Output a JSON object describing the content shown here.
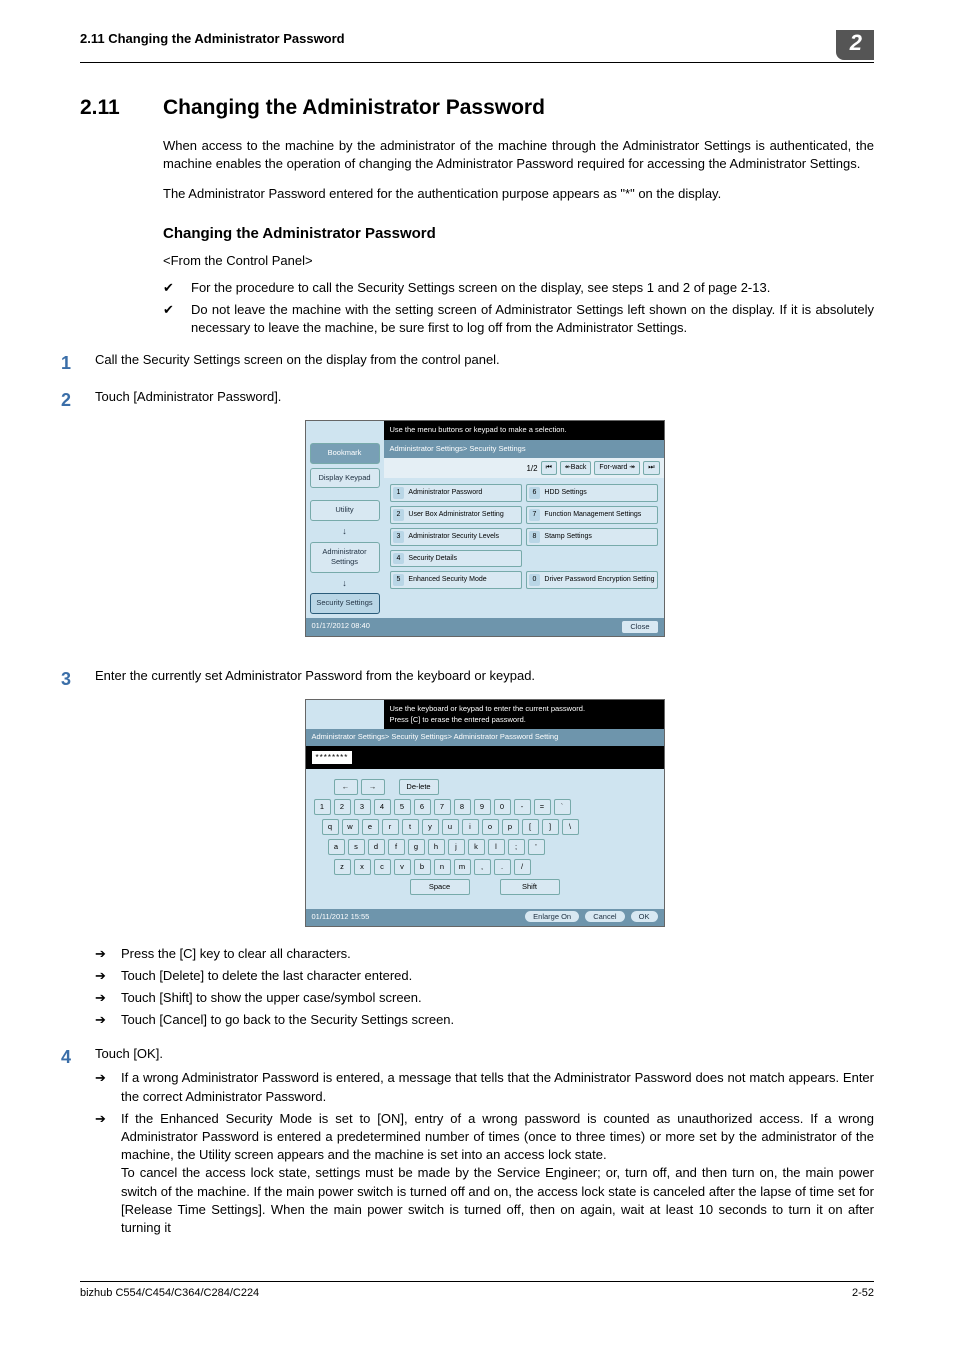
{
  "header": {
    "left": "2.11    Changing the Administrator Password",
    "chapter": "2"
  },
  "section": {
    "num": "2.11",
    "title": "Changing the Administrator Password"
  },
  "para1": "When access to the machine by the administrator of the machine through the Administrator Settings is authenticated, the machine enables the operation of changing the Administrator Password required for accessing the Administrator Settings.",
  "para2": "The Administrator Password entered for the authentication purpose appears as \"*\" on the display.",
  "subhead": "Changing the Administrator Password",
  "angle": "<From the Control Panel>",
  "tick1": "For the procedure to call the Security Settings screen on the display, see steps 1 and 2 of page 2-13.",
  "tick2": "Do not leave the machine with the setting screen of Administrator Settings left shown on the display. If it is absolutely necessary to leave the machine, be sure first to log off from the Administrator Settings.",
  "steps": {
    "s1": {
      "n": "1",
      "t": "Call the Security Settings screen on the display from the control panel."
    },
    "s2": {
      "n": "2",
      "t": "Touch [Administrator Password]."
    },
    "s3": {
      "n": "3",
      "t": "Enter the currently set Administrator Password from the keyboard or keypad."
    },
    "s4": {
      "n": "4",
      "t": "Touch [OK]."
    }
  },
  "sublist3": {
    "a": "Press the [C] key to clear all characters.",
    "b": "Touch [Delete] to delete the last character entered.",
    "c": "Touch [Shift] to show the upper case/symbol screen.",
    "d": "Touch [Cancel] to go back to the Security Settings screen."
  },
  "sublist4": {
    "a": "If a wrong Administrator Password is entered, a message that tells that the Administrator Password does not match appears. Enter the correct Administrator Password.",
    "b": "If the Enhanced Security Mode is set to [ON], entry of a wrong password is counted as unauthorized access. If a wrong Administrator Password is entered a predetermined number of times (once to three times) or more set by the administrator of the machine, the Utility screen appears and the machine is set into an access lock state.",
    "b2": "To cancel the access lock state, settings must be made by the Service Engineer; or, turn off, and then turn on, the main power switch of the machine. If the main power switch is turned off and on, the access lock state is canceled after the lapse of time set for [Release Time Settings]. When the main power switch is turned off, then on again, wait at least 10 seconds to turn it on after turning it"
  },
  "screen1": {
    "hint": "Use the menu buttons or keypad to make a selection.",
    "bar": "Administrator Settings> Security Settings",
    "pager": {
      "count": "1/2",
      "back": "↞Back",
      "fwd": "For-ward ↠"
    },
    "side": {
      "bookmark": "Bookmark",
      "keypad": "Display Keypad",
      "utility": "Utility",
      "admin": "Administrator Settings",
      "security": "Security Settings"
    },
    "opts": {
      "o1": "Administrator Password",
      "o6": "HDD Settings",
      "o2": "User Box Administrator Setting",
      "o7": "Function Management Settings",
      "o3": "Administrator Security Levels",
      "o8": "Stamp Settings",
      "o4": "Security Details",
      "o5": "Enhanced Security Mode",
      "o0": "Driver Password Encryption Setting"
    },
    "foot": {
      "dt": "01/17/2012   08:40",
      "close": "Close"
    }
  },
  "screen2": {
    "hint": "Use the keyboard or keypad to enter the current password.\nPress [C] to erase the entered password.",
    "bar": "Administrator Settings> Security Settings> Administrator Password Setting",
    "input": "********",
    "delete": "De-lete",
    "rows": {
      "r0a": "←",
      "r0b": "→",
      "r1": [
        "1",
        "2",
        "3",
        "4",
        "5",
        "6",
        "7",
        "8",
        "9",
        "0",
        "-",
        "=",
        "`"
      ],
      "r2": [
        "q",
        "w",
        "e",
        "r",
        "t",
        "y",
        "u",
        "i",
        "o",
        "p",
        "[",
        "]",
        "\\"
      ],
      "r3": [
        "a",
        "s",
        "d",
        "f",
        "g",
        "h",
        "j",
        "k",
        "l",
        ";",
        "'"
      ],
      "r4": [
        "z",
        "x",
        "c",
        "v",
        "b",
        "n",
        "m",
        ",",
        ".",
        "/"
      ],
      "space": "Space",
      "shift": "Shift"
    },
    "foot": {
      "dt": "01/11/2012   15:55",
      "enlarge": "Enlarge On",
      "cancel": "Cancel",
      "ok": "OK"
    }
  },
  "footer": {
    "left": "bizhub C554/C454/C364/C284/C224",
    "right": "2-52"
  }
}
